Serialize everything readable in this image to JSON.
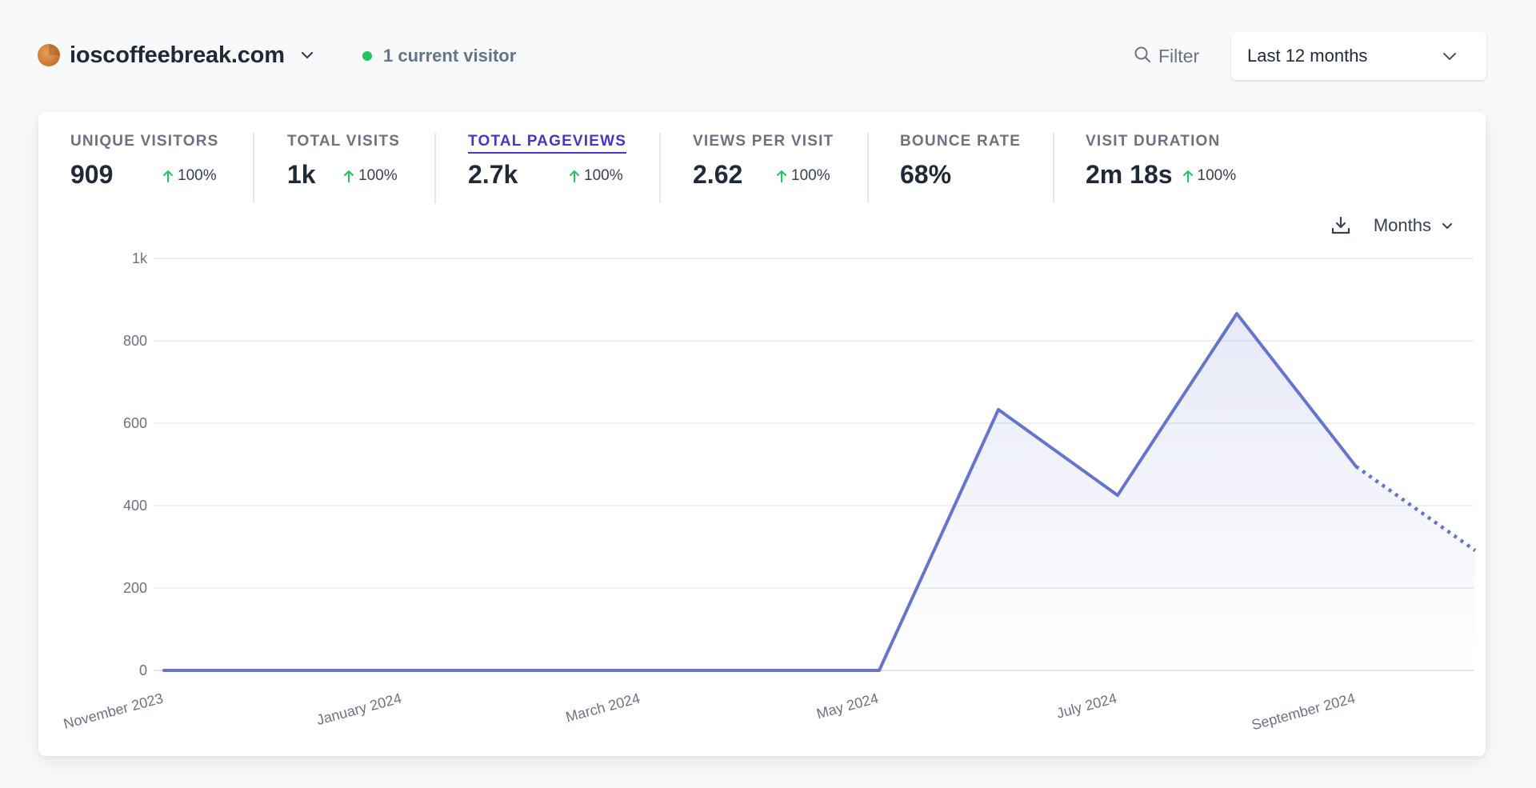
{
  "header": {
    "site": {
      "name": "ioscoffeebreak.com",
      "favicon": "coffee-bean-favicon",
      "favicon_color": "#cf7d35"
    },
    "live_visitors": {
      "label": "1 current visitor",
      "dot_color": "#22c55e"
    },
    "filter": {
      "label": "Filter",
      "icon": "search-icon"
    },
    "date_range": {
      "selected": "Last 12 months",
      "icon": "chevron-down-icon"
    }
  },
  "stats": [
    {
      "label": "Unique visitors",
      "value": "909",
      "change": "100%",
      "direction": "up",
      "active": false
    },
    {
      "label": "Total visits",
      "value": "1k",
      "change": "100%",
      "direction": "up",
      "active": false
    },
    {
      "label": "Total pageviews",
      "value": "2.7k",
      "change": "100%",
      "direction": "up",
      "active": true
    },
    {
      "label": "Views per visit",
      "value": "2.62",
      "change": "100%",
      "direction": "up",
      "active": false
    },
    {
      "label": "Bounce rate",
      "value": "68%",
      "change": null,
      "direction": null,
      "active": false
    },
    {
      "label": "Visit duration",
      "value": "2m 18s",
      "change": "100%",
      "direction": "up",
      "active": false
    }
  ],
  "controls": {
    "download": {
      "icon": "download-icon"
    },
    "interval": {
      "selected": "Months",
      "icon": "chevron-down-icon"
    }
  },
  "colors": {
    "accent": "#4338ca",
    "line": "#6574cd",
    "positive": "#22c55e",
    "grid": "#e5e7eb"
  },
  "chart_data": {
    "type": "line",
    "title": "",
    "metric": "Total pageviews",
    "xlabel": "",
    "ylabel": "",
    "x": [
      "November 2023",
      "December 2023",
      "January 2024",
      "February 2024",
      "March 2024",
      "April 2024",
      "May 2024",
      "June 2024",
      "July 2024",
      "August 2024",
      "September 2024",
      "October 2024"
    ],
    "series": [
      {
        "name": "Total pageviews",
        "values": [
          0,
          0,
          0,
          0,
          0,
          0,
          0,
          633,
          425,
          866,
          495,
          291
        ],
        "incomplete_from_index": 10
      }
    ],
    "x_tick_labels": [
      "November 2023",
      "January 2024",
      "March 2024",
      "May 2024",
      "July 2024",
      "September 2024"
    ],
    "y_tick_labels": [
      "0",
      "200",
      "400",
      "600",
      "800",
      "1k"
    ],
    "y_ticks": [
      0,
      200,
      400,
      600,
      800,
      1000
    ],
    "ylim": [
      0,
      1000
    ],
    "grid": true,
    "area_fill": true,
    "legend": "none"
  }
}
